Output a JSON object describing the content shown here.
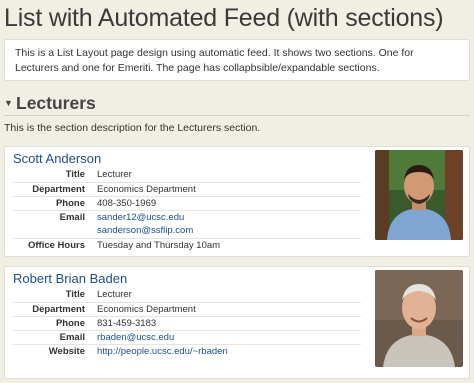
{
  "page": {
    "title": "List with Automated Feed (with sections)",
    "intro": "This is a List Layout page design using automatic feed. It shows two sections. One for Lecturers and one for Emeriti. The page has collapbsible/expandable sections."
  },
  "section": {
    "toggle_icon": "collapse-triangle-icon",
    "title": "Lecturers",
    "description": "This is the section description for the Lecturers section."
  },
  "people": [
    {
      "name": "Scott Anderson",
      "fields": {
        "title_label": "Title",
        "title": "Lecturer",
        "department_label": "Department",
        "department": "Economics Department",
        "phone_label": "Phone",
        "phone": "408-350-1969",
        "email_label": "Email",
        "email": "sander12@ucsc.edu",
        "email2": "sanderson@ssflip.com",
        "office_label": "Office Hours",
        "office": "Tuesday and Thursday 10am"
      }
    },
    {
      "name": "Robert Brian Baden",
      "fields": {
        "title_label": "Title",
        "title": "Lecturer",
        "department_label": "Department",
        "department": "Economics Department",
        "phone_label": "Phone",
        "phone": "831-459-3183",
        "email_label": "Email",
        "email": "rbaden@ucsc.edu",
        "website_label": "Website",
        "website": "http://people.ucsc.edu/~rbaden"
      }
    }
  ]
}
